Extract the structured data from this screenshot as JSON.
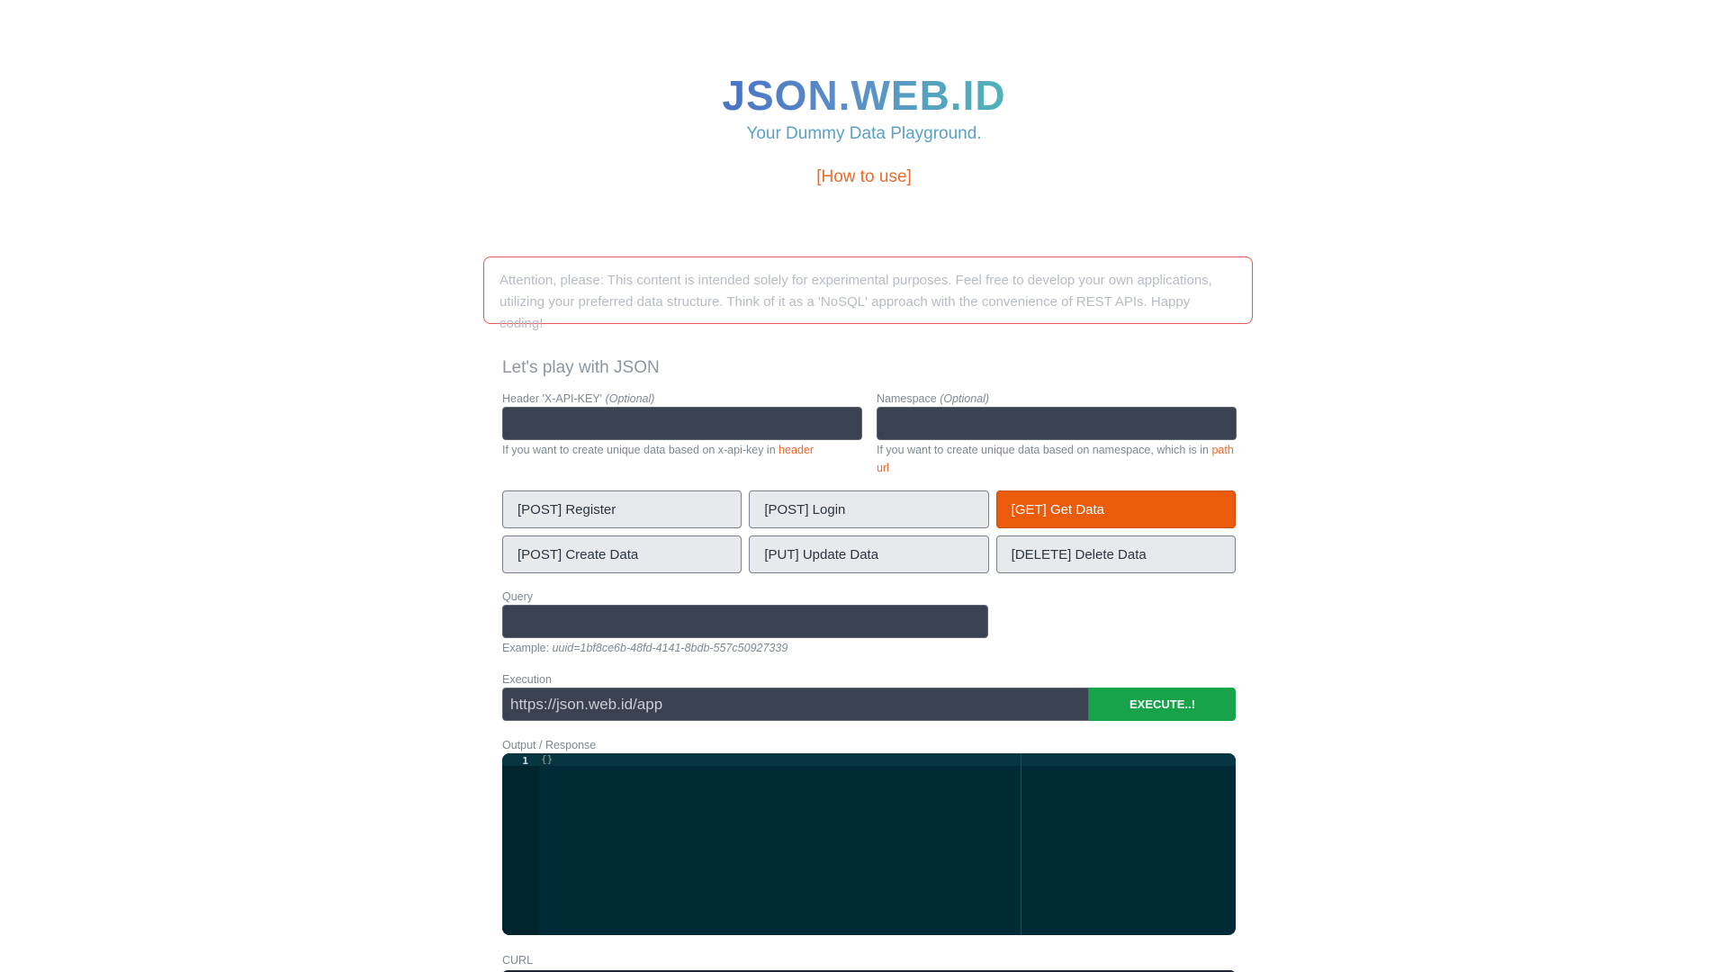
{
  "header": {
    "title": "JSON.WEB.ID",
    "tagline": "Your Dummy Data Playground.",
    "how_to_use": "[How to use]"
  },
  "alert": {
    "text": "Attention, please: This content is intended solely for experimental purposes. Feel free to develop your own applications, utilizing your preferred data structure. Think of it as a 'NoSQL' approach with the convenience of REST APIs. Happy coding!"
  },
  "form": {
    "section_title": "Let's play with JSON",
    "api_key": {
      "label": "Header 'X-API-KEY'",
      "optional": "(Optional)",
      "value": "",
      "hint": "If you want to create unique data based on x-api-key in",
      "hint_accent": "header"
    },
    "namespace": {
      "label": "Namespace",
      "optional": "(Optional)",
      "value": "",
      "hint": "If you want to create unique data based on namespace, which is in",
      "hint_accent": "path url"
    },
    "buttons": [
      {
        "label": "[POST] Register"
      },
      {
        "label": "[POST] Login"
      },
      {
        "label": "[GET] Get Data"
      },
      {
        "label": "[POST] Create Data"
      },
      {
        "label": "[PUT] Update Data"
      },
      {
        "label": "[DELETE] Delete Data"
      }
    ],
    "active_button": "[GET] Get Data",
    "query": {
      "label": "Query",
      "value": "",
      "example_prefix": "Example:",
      "example": "uuid=1bf8ce6b-48fd-4141-8bdb-557c50927339"
    },
    "execution": {
      "label": "Execution",
      "url": "https://json.web.id/app",
      "button": "EXECUTE..!"
    },
    "output": {
      "label": "Output / Response",
      "line_number": "1",
      "content": "{}"
    },
    "curl": {
      "label": "CURL"
    }
  },
  "colors": {
    "accent_orange": "#ea5b0c",
    "execute_green": "#16a34a",
    "input_dark": "#3a4150",
    "editor_bg": "#002b36",
    "alert_border": "#e35a5a"
  }
}
